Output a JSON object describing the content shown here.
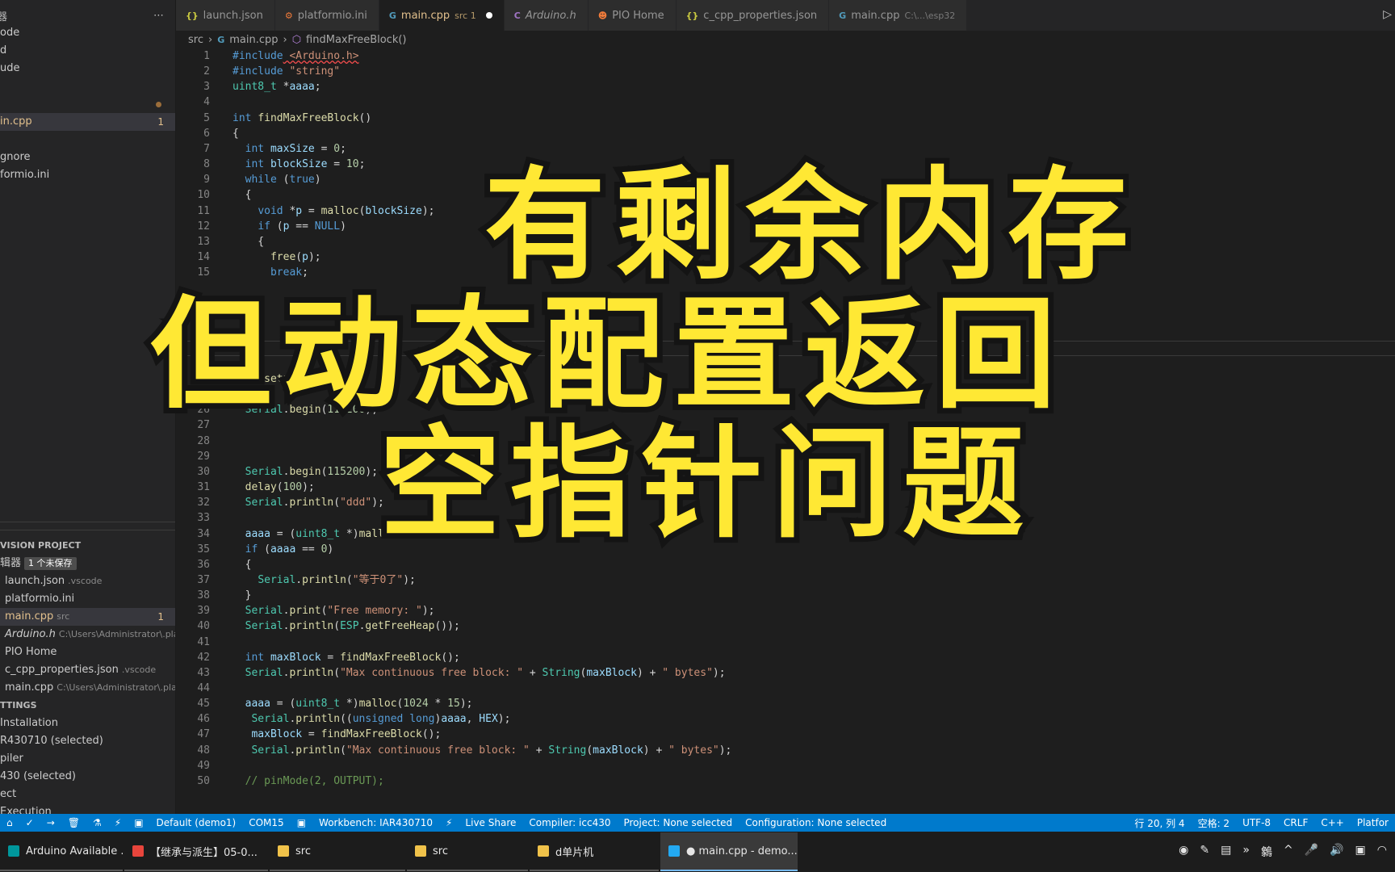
{
  "sidebar": {
    "header_label": "器",
    "more_icon": "ellipsis-icon",
    "explorer_items": [
      {
        "label": "ode"
      },
      {
        "label": "d"
      },
      {
        "label": "ude"
      },
      {
        "label": ""
      },
      {
        "label": ""
      },
      {
        "label": "in.cpp",
        "badge": "1",
        "active": true
      },
      {
        "label": ""
      },
      {
        "label": "gnore"
      },
      {
        "label": "formio.ini"
      }
    ],
    "project_section": "VISION PROJECT",
    "open_editors_label": "辑器",
    "unsaved_badge": "1 个未保存",
    "open_editors": [
      {
        "name": "launch.json",
        "path": ".vscode"
      },
      {
        "name": "platformio.ini",
        "path": ""
      },
      {
        "name": "main.cpp",
        "path": "src",
        "badge": "1",
        "active": true
      },
      {
        "name": "Arduino.h",
        "path": "C:\\Users\\Administrator\\.pla..."
      },
      {
        "name": "PIO Home",
        "path": ""
      },
      {
        "name": "c_cpp_properties.json",
        "path": ".vscode"
      },
      {
        "name": "main.cpp",
        "path": "C:\\Users\\Administrator\\.pla..."
      }
    ],
    "settings_section": "TTINGS",
    "settings_items": [
      "Installation",
      "R430710 (selected)",
      "piler",
      "430 (selected)",
      "ect",
      "Execution"
    ]
  },
  "tabs": [
    {
      "icon": "{}",
      "label": "launch.json",
      "hint": ""
    },
    {
      "icon": "⚙",
      "label": "platformio.ini",
      "hint": ""
    },
    {
      "icon": "G",
      "label": "main.cpp",
      "hint": "src 1",
      "active": true,
      "unsaved": true
    },
    {
      "icon": "C",
      "label": "Arduino.h",
      "hint": ""
    },
    {
      "icon": "☻",
      "label": "PIO Home",
      "hint": ""
    },
    {
      "icon": "{}",
      "label": "c_cpp_properties.json",
      "hint": ""
    },
    {
      "icon": "G",
      "label": "main.cpp",
      "hint": "C:\\...\\esp32"
    }
  ],
  "breadcrumb": {
    "folder": "src",
    "file": "main.cpp",
    "symbol": "findMaxFreeBlock()"
  },
  "code_lines": [
    {
      "n": "1",
      "text": "#include <Arduino.h>"
    },
    {
      "n": "2",
      "text": "#include \"string\""
    },
    {
      "n": "3",
      "text": "uint8_t *aaaa;"
    },
    {
      "n": "4",
      "text": ""
    },
    {
      "n": "5",
      "text": "int findMaxFreeBlock()"
    },
    {
      "n": "6",
      "text": "{"
    },
    {
      "n": "7",
      "text": "  int maxSize = 0;"
    },
    {
      "n": "8",
      "text": "  int blockSize = 10;"
    },
    {
      "n": "9",
      "text": "  while (true)"
    },
    {
      "n": "10",
      "text": "  {"
    },
    {
      "n": "11",
      "text": "    void *p = malloc(blockSize);"
    },
    {
      "n": "12",
      "text": "    if (p == NULL)"
    },
    {
      "n": "13",
      "text": "    {"
    },
    {
      "n": "14",
      "text": "      free(p);"
    },
    {
      "n": "15",
      "text": "      break;"
    },
    {
      "n": "24",
      "text": "void setup()"
    },
    {
      "n": "25",
      "text": "{"
    },
    {
      "n": "26",
      "text": "  Serial.begin(115200);"
    },
    {
      "n": "27",
      "text": ""
    },
    {
      "n": "28",
      "text": ""
    },
    {
      "n": "29",
      "text": ""
    },
    {
      "n": "30",
      "text": "  Serial.begin(115200);"
    },
    {
      "n": "31",
      "text": "  delay(100);"
    },
    {
      "n": "32",
      "text": "  Serial.println(\"ddd\");"
    },
    {
      "n": "33",
      "text": ""
    },
    {
      "n": "34",
      "text": "  aaaa = (uint8_t *)malloc(1024 * 107);"
    },
    {
      "n": "35",
      "text": "  if (aaaa == 0)"
    },
    {
      "n": "36",
      "text": "  {"
    },
    {
      "n": "37",
      "text": "    Serial.println(\"等于0了\");"
    },
    {
      "n": "38",
      "text": "  }"
    },
    {
      "n": "39",
      "text": "  Serial.print(\"Free memory: \");"
    },
    {
      "n": "40",
      "text": "  Serial.println(ESP.getFreeHeap());"
    },
    {
      "n": "41",
      "text": ""
    },
    {
      "n": "42",
      "text": "  int maxBlock = findMaxFreeBlock();"
    },
    {
      "n": "43",
      "text": "  Serial.println(\"Max continuous free block: \" + String(maxBlock) + \" bytes\");"
    },
    {
      "n": "44",
      "text": ""
    },
    {
      "n": "45",
      "text": "  aaaa = (uint8_t *)malloc(1024 * 15);"
    },
    {
      "n": "46",
      "text": "   Serial.println((unsigned long)aaaa, HEX);"
    },
    {
      "n": "47",
      "text": "   maxBlock = findMaxFreeBlock();"
    },
    {
      "n": "48",
      "text": "   Serial.println(\"Max continuous free block: \" + String(maxBlock) + \" bytes\");"
    },
    {
      "n": "49",
      "text": ""
    },
    {
      "n": "50",
      "text": "  // pinMode(2, OUTPUT);"
    }
  ],
  "statusbar": {
    "left": [
      "⌂",
      "✓",
      "→",
      "🗑",
      "⚗",
      "⚡",
      "▣",
      "Default (demo1)",
      "COM15",
      "▣",
      "Workbench: IAR430710",
      "⚡",
      "Live Share",
      "Compiler: icc430",
      "Project: None selected",
      "Configuration: None selected"
    ],
    "right": [
      "行 20, 列 4",
      "空格: 2",
      "UTF-8",
      "CRLF",
      "C++",
      "Platfor"
    ]
  },
  "taskbar": {
    "items": [
      {
        "label": "Arduino Available ...",
        "color": "#00979c"
      },
      {
        "label": "【继承与派生】05-0...",
        "color": "#e8453c"
      },
      {
        "label": "src",
        "color": "#f0c24a"
      },
      {
        "label": "src",
        "color": "#f0c24a"
      },
      {
        "label": "d单片机",
        "color": "#f0c24a"
      },
      {
        "label": "● main.cpp - demo...",
        "color": "#23a9f2",
        "active": true
      }
    ],
    "tray": [
      "◉",
      "✎",
      "▤",
      "»",
      "䴂",
      "^",
      "🎤",
      "🔊",
      "▣",
      "◠"
    ]
  },
  "overlay": {
    "line1": "有剩余内存",
    "line2": "但动态配置返回",
    "line3": "空指针问题"
  },
  "colors": {
    "accent": "#007acc",
    "overlay_text": "#ffe834",
    "modified": "#e2c08d"
  }
}
